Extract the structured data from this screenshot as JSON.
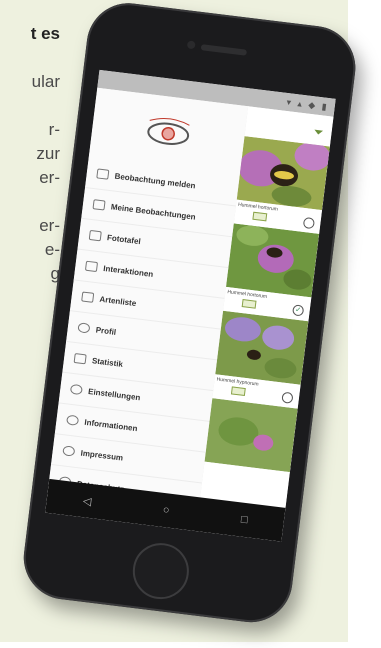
{
  "background_text": {
    "lines": [
      "t es",
      "",
      "ular",
      "",
      "r-",
      "zur",
      "er-",
      "",
      "er-",
      "e-",
      "g"
    ]
  },
  "status_bar": {
    "icons": "▾ ▴ ◆ ▮"
  },
  "drawer": {
    "menu_items": [
      {
        "label": "Beobachtung melden",
        "icon": "camera-icon"
      },
      {
        "label": "Meine Beobachtungen",
        "icon": "folder-icon"
      },
      {
        "label": "Fototafel",
        "icon": "image-icon"
      },
      {
        "label": "Interaktionen",
        "icon": "warning-icon"
      },
      {
        "label": "Artenliste",
        "icon": "list-icon"
      },
      {
        "label": "Profil",
        "icon": "user-icon"
      },
      {
        "label": "Statistik",
        "icon": "chart-icon"
      },
      {
        "label": "Einstellungen",
        "icon": "gear-icon"
      },
      {
        "label": "Informationen",
        "icon": "info-icon"
      },
      {
        "label": "Impressum",
        "icon": "info-icon"
      },
      {
        "label": "Datenschutz",
        "icon": "shield-icon"
      }
    ]
  },
  "content": {
    "filter_icon": "filter-icon",
    "photos": [
      {
        "caption": "Hummel hortorum",
        "tag": "",
        "status": "empty"
      },
      {
        "caption": "Hummel hortorum",
        "tag": "",
        "status": "checked"
      },
      {
        "caption": "Hummel hypnorum",
        "tag": "",
        "status": "empty"
      }
    ]
  },
  "nav_bar": {
    "back": "◁",
    "home": "○",
    "recent": "□"
  },
  "colors": {
    "side_panel": "#eef1df",
    "accent_green": "#6b8f3a",
    "logo_red": "#c0392b"
  }
}
